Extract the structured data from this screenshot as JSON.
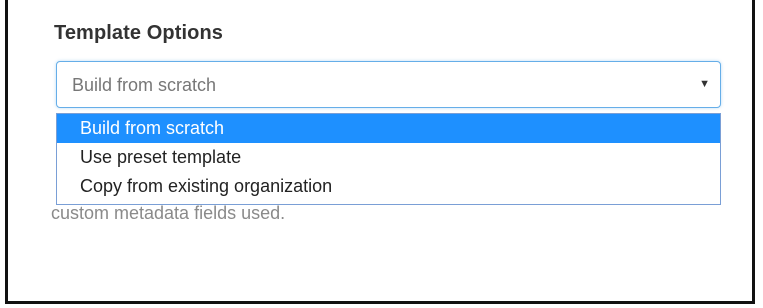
{
  "template_options": {
    "title": "Template Options",
    "select": {
      "value": "Build from scratch",
      "caret_icon": "caret-down-icon"
    },
    "options": [
      {
        "label": "Build from scratch",
        "selected": true
      },
      {
        "label": "Use preset template",
        "selected": false
      },
      {
        "label": "Copy from existing organization",
        "selected": false
      }
    ],
    "hint": "custom metadata fields used."
  },
  "colors": {
    "selected_background": "#1e90ff",
    "focus_border": "#66aee8"
  }
}
